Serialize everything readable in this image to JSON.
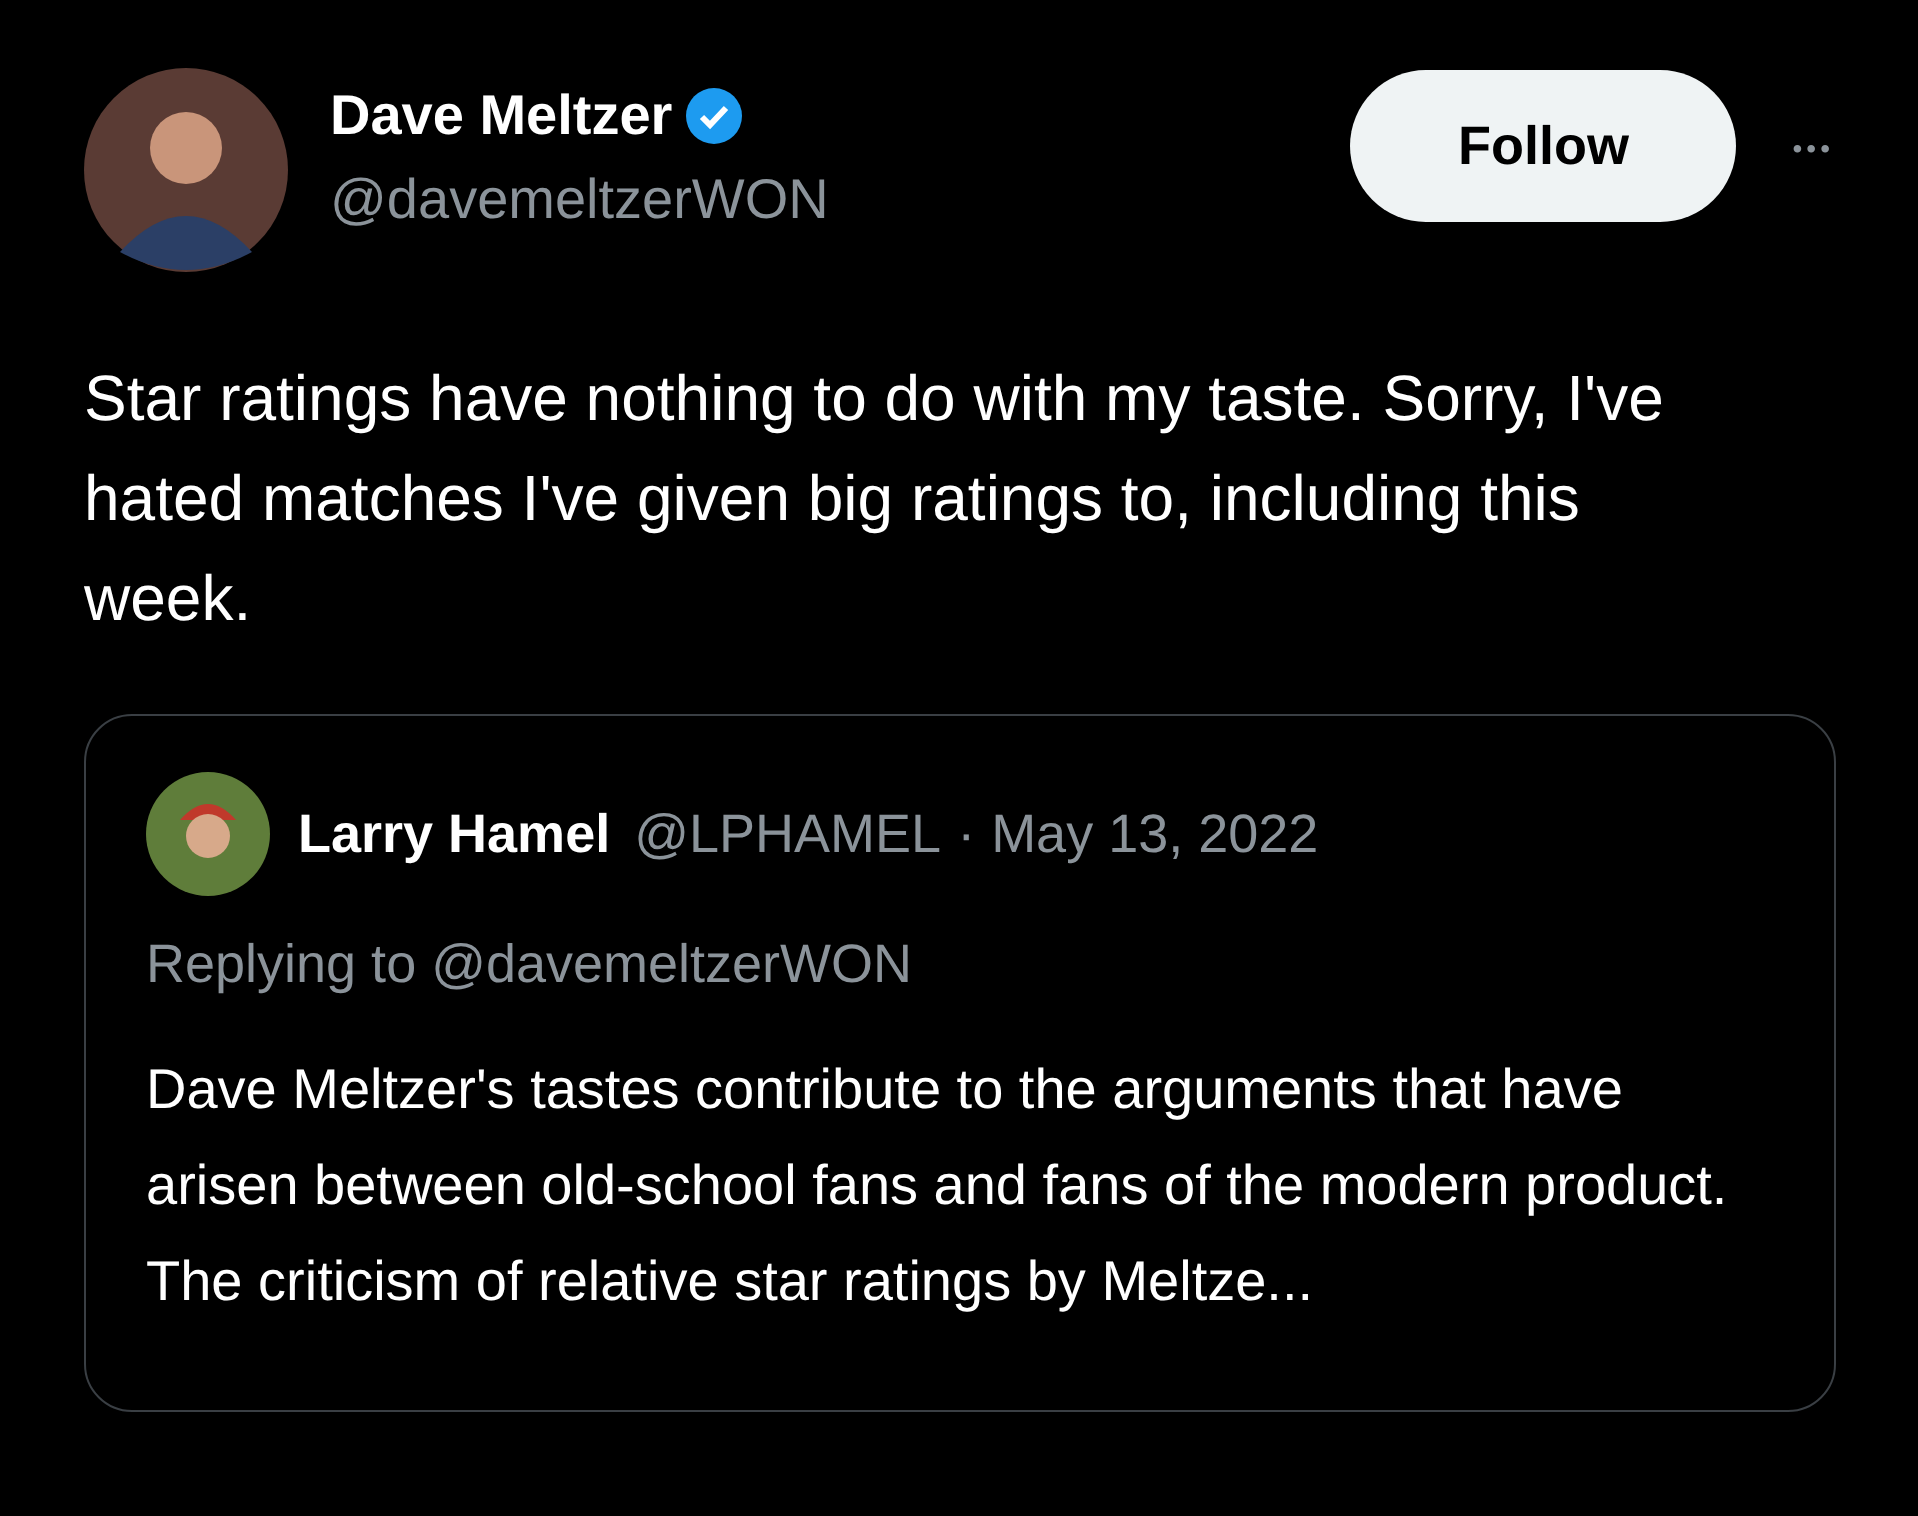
{
  "tweet": {
    "author": {
      "name": "Dave Meltzer",
      "handle": "@davemeltzerWON",
      "verified": true
    },
    "follow_button": "Follow",
    "more": "•••",
    "text": "Star ratings have nothing to do with my taste.  Sorry, I've hated matches I've given big ratings to, including this week.",
    "quoted": {
      "name": "Larry Hamel",
      "handle": "@LPHAMEL",
      "separator": "·",
      "date": "May 13, 2022",
      "replying_to": "Replying to @davemeltzerWON",
      "text": "Dave Meltzer's tastes contribute to the arguments that have arisen between old-school fans and fans of the modern product. The criticism of relative star ratings by Meltze..."
    }
  }
}
